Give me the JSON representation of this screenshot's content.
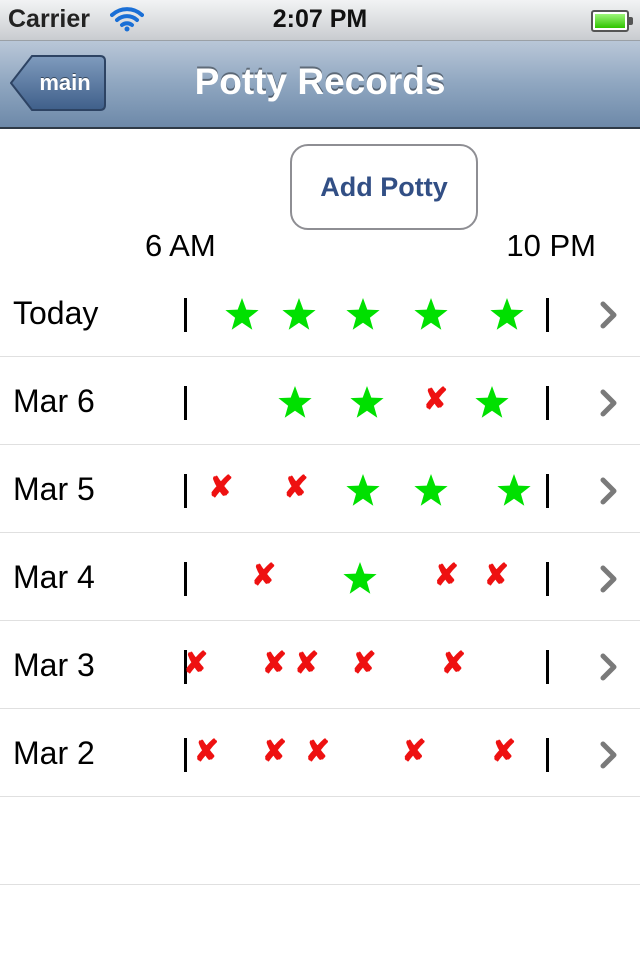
{
  "status_bar": {
    "carrier": "Carrier",
    "time": "2:07 PM",
    "battery_level": 1.0
  },
  "nav": {
    "back_label": "main",
    "title": "Potty Records"
  },
  "add_button_label": "Add Potty",
  "axis": {
    "start": "6 AM",
    "end": "10 PM"
  },
  "colors": {
    "success": "#00e000",
    "accident": "#ee1111",
    "nav_bar": "#8fa6c0"
  },
  "rows": [
    {
      "label": "Today",
      "events": [
        {
          "type": "success",
          "t": 0.15
        },
        {
          "type": "success",
          "t": 0.31
        },
        {
          "type": "success",
          "t": 0.49
        },
        {
          "type": "success",
          "t": 0.68
        },
        {
          "type": "success",
          "t": 0.89
        }
      ]
    },
    {
      "label": "Mar 6",
      "events": [
        {
          "type": "success",
          "t": 0.3
        },
        {
          "type": "success",
          "t": 0.5
        },
        {
          "type": "accident",
          "t": 0.69
        },
        {
          "type": "success",
          "t": 0.85
        }
      ]
    },
    {
      "label": "Mar 5",
      "events": [
        {
          "type": "accident",
          "t": 0.09
        },
        {
          "type": "accident",
          "t": 0.3
        },
        {
          "type": "success",
          "t": 0.49
        },
        {
          "type": "success",
          "t": 0.68
        },
        {
          "type": "success",
          "t": 0.91
        }
      ]
    },
    {
      "label": "Mar 4",
      "events": [
        {
          "type": "accident",
          "t": 0.21
        },
        {
          "type": "success",
          "t": 0.48
        },
        {
          "type": "accident",
          "t": 0.72
        },
        {
          "type": "accident",
          "t": 0.86
        }
      ]
    },
    {
      "label": "Mar 3",
      "events": [
        {
          "type": "accident",
          "t": 0.02
        },
        {
          "type": "accident",
          "t": 0.24
        },
        {
          "type": "accident",
          "t": 0.33
        },
        {
          "type": "accident",
          "t": 0.49
        },
        {
          "type": "accident",
          "t": 0.74
        }
      ]
    },
    {
      "label": "Mar 2",
      "events": [
        {
          "type": "accident",
          "t": 0.05
        },
        {
          "type": "accident",
          "t": 0.24
        },
        {
          "type": "accident",
          "t": 0.36
        },
        {
          "type": "accident",
          "t": 0.63
        },
        {
          "type": "accident",
          "t": 0.88
        }
      ]
    }
  ]
}
